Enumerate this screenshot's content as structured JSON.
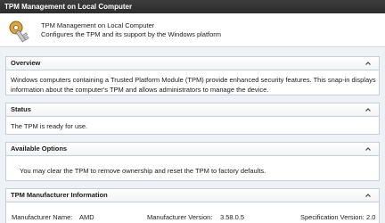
{
  "window": {
    "title": "TPM Management on Local Computer"
  },
  "header": {
    "icon": "key-icon",
    "title": "TPM Management on Local Computer",
    "subtitle": "Configures the TPM and its support by the Windows platform"
  },
  "sections": {
    "overview": {
      "title": "Overview",
      "line1": "Windows computers containing a Trusted Platform Module (TPM) provide enhanced security features. This snap-in displays",
      "line2": "information about the computer's TPM and allows administrators to manage the device."
    },
    "status": {
      "title": "Status",
      "text": "The TPM is ready for use."
    },
    "options": {
      "title": "Available Options",
      "text": "You may clear the TPM to remove ownership and reset the TPM to factory defaults."
    },
    "manufacturer": {
      "title": "TPM Manufacturer Information",
      "name_label": "Manufacturer Name:",
      "name_value": "AMD",
      "version_label": "Manufacturer Version:",
      "version_value": "3.58.0.5",
      "spec_label": "Specification Version:",
      "spec_value": "2.0"
    }
  },
  "icons": {
    "collapse": "chevron-up-icon"
  },
  "colors": {
    "title_bar": "#2c2c2c",
    "content_bg": "#eef1f5",
    "section_border": "#c9ced6"
  }
}
